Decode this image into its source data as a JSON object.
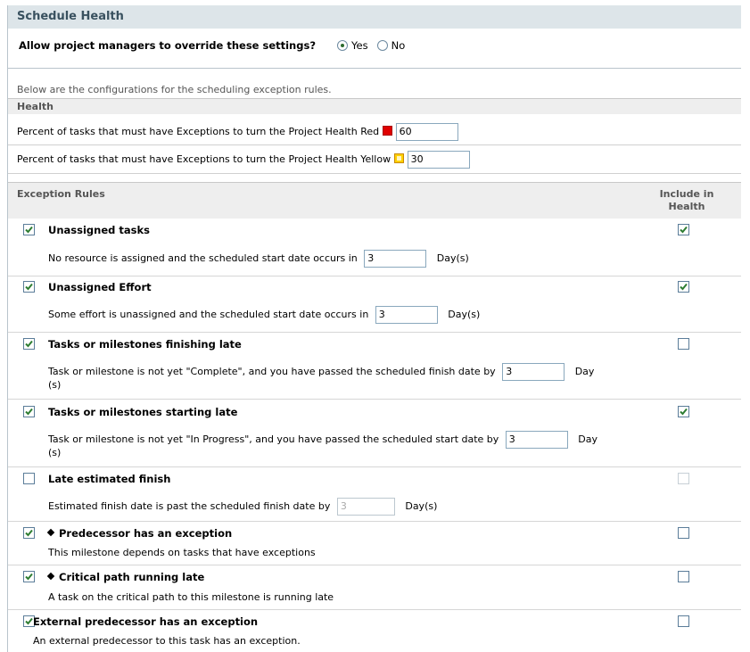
{
  "title": "Schedule Health",
  "override": {
    "question": "Allow project managers to override these settings?",
    "yes": "Yes",
    "no": "No",
    "selected": "Yes"
  },
  "description": "Below are the configurations for the scheduling exception rules.",
  "health": {
    "heading": "Health",
    "red_label": "Percent of tasks that must have Exceptions to turn the Project Health Red",
    "red_value": "60",
    "yellow_label": "Percent of tasks that must have Exceptions to turn the Project Health Yellow",
    "yellow_value": "30"
  },
  "rules_header": {
    "left": "Exception Rules",
    "right_line1": "Include in",
    "right_line2": "Health"
  },
  "rules": [
    {
      "title": "Unassigned tasks",
      "desc": "No resource is assigned and the scheduled start date occurs in",
      "value": "3",
      "unit": "Day(s)",
      "enabled": true,
      "include": true
    },
    {
      "title": "Unassigned Effort",
      "desc": "Some effort is unassigned and the scheduled start date occurs in",
      "value": "3",
      "unit": "Day(s)",
      "enabled": true,
      "include": true
    },
    {
      "title": "Tasks or milestones finishing late",
      "desc": "Task or milestone is not yet \"Complete\", and you have passed the scheduled finish date by",
      "value": "3",
      "unit": "Day",
      "unit2": "(s)",
      "enabled": true,
      "include": false
    },
    {
      "title": "Tasks or milestones starting late",
      "desc": "Task or milestone is not yet \"In Progress\", and you have passed the scheduled start date by",
      "value": "3",
      "unit": "Day",
      "unit2": "(s)",
      "enabled": true,
      "include": true
    },
    {
      "title": "Late estimated finish",
      "desc": "Estimated finish date is past the scheduled finish date by",
      "value": "3",
      "unit": "Day(s)",
      "enabled": false,
      "include": false
    },
    {
      "title": "Predecessor has an exception",
      "desc": "This milestone depends on tasks that have exceptions",
      "enabled": true,
      "include": false
    },
    {
      "title": "Critical path running late",
      "desc": "A task on the critical path to this milestone is running late",
      "enabled": true,
      "include": false
    },
    {
      "title": "External predecessor has an exception",
      "desc": "An external predecessor to this task has an exception.",
      "enabled": true,
      "include": false
    }
  ],
  "colors": {
    "header_bg": "#dde5e9",
    "title": "#39515f",
    "check": "#2e7d32",
    "health_red": "#e00000",
    "health_yellow": "#ffd000"
  }
}
